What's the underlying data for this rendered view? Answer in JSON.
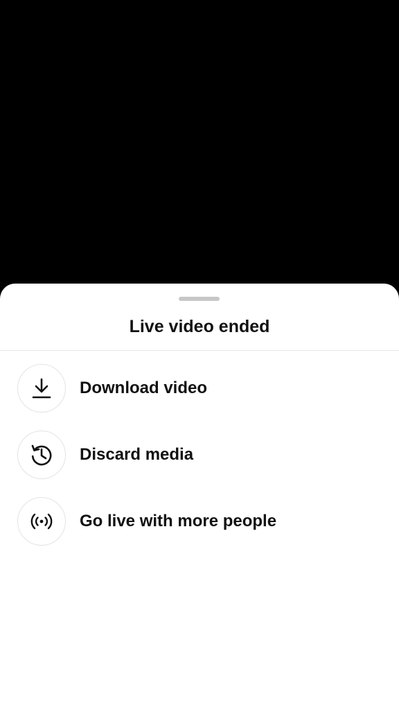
{
  "sheet": {
    "title": "Live video ended",
    "options": [
      {
        "label": "Download video",
        "icon": "download-icon"
      },
      {
        "label": "Discard media",
        "icon": "history-icon"
      },
      {
        "label": "Go live with more people",
        "icon": "broadcast-icon"
      }
    ]
  },
  "colors": {
    "background": "#000000",
    "sheet": "#ffffff",
    "text": "#111111",
    "handle": "#c7c7c7",
    "divider": "#e6e6e6"
  }
}
